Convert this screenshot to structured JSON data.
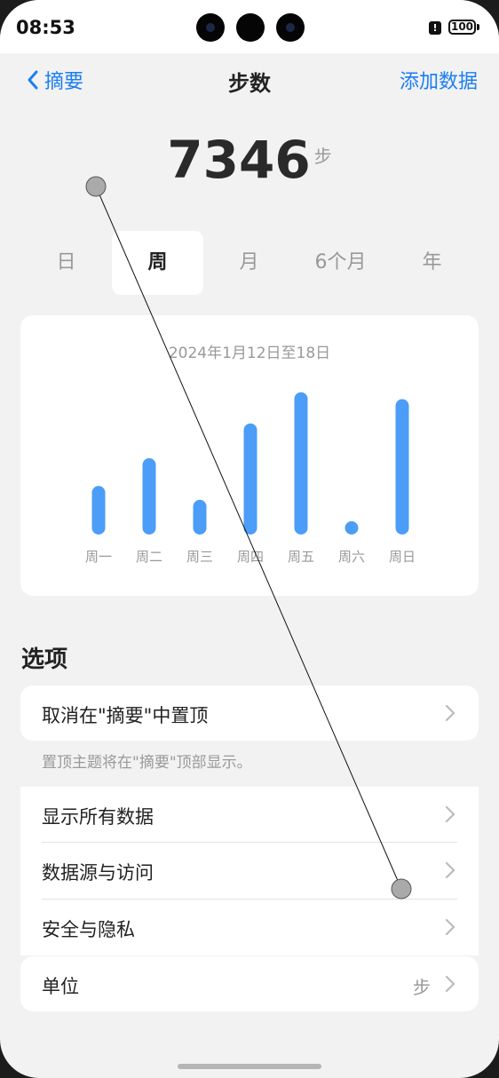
{
  "status": {
    "time": "08:53",
    "alert": "!",
    "battery": "100"
  },
  "nav": {
    "back_label": "摘要",
    "title": "步数",
    "add_label": "添加数据"
  },
  "summary": {
    "total": "7346",
    "unit": "步"
  },
  "tabs": [
    {
      "label": "日",
      "active": false
    },
    {
      "label": "周",
      "active": true
    },
    {
      "label": "月",
      "active": false
    },
    {
      "label": "6个月",
      "active": false
    },
    {
      "label": "年",
      "active": false
    }
  ],
  "chart_data": {
    "type": "bar",
    "title": "2024年1月12日至18日",
    "categories": [
      "周一",
      "周二",
      "周三",
      "周四",
      "周五",
      "周六",
      "周日"
    ],
    "values": [
      700,
      1100,
      500,
      1600,
      2050,
      120,
      1950
    ],
    "ylim": [
      0,
      2200
    ],
    "grid": false,
    "bar_color": "#4b9df7",
    "label_color": "#999999"
  },
  "options": {
    "section_title": "选项",
    "unpin_label": "取消在\"摘要\"中置顶",
    "pin_hint": "置顶主题将在\"摘要\"顶部显示。",
    "show_all_label": "显示所有数据",
    "sources_label": "数据源与访问",
    "privacy_label": "安全与隐私",
    "unit_label": "单位",
    "unit_value": "步"
  },
  "colors": {
    "accent": "#1a7ef2",
    "background": "#f2f2f2",
    "card": "#ffffff"
  }
}
